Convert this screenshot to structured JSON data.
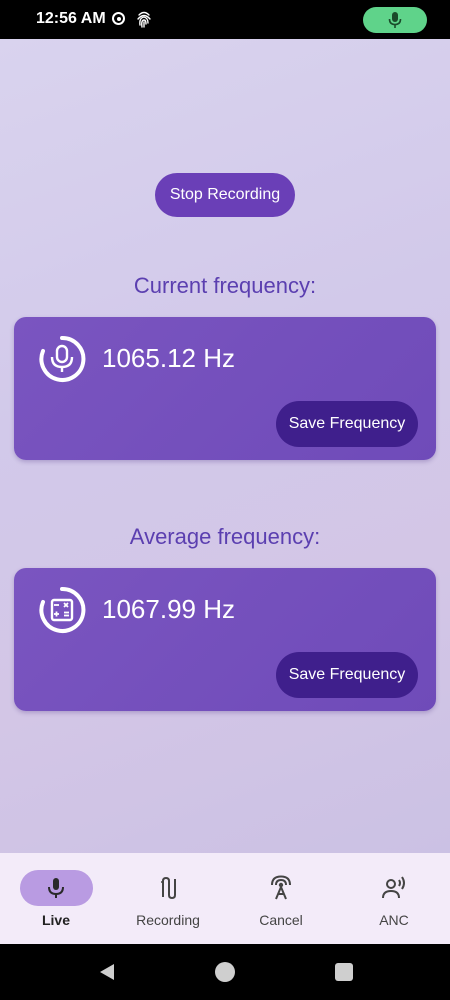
{
  "status_bar": {
    "time": "12:56 AM"
  },
  "main": {
    "stop_button": "Stop Recording",
    "current": {
      "title": "Current frequency:",
      "value": "1065.12 Hz",
      "save_label": "Save Frequency"
    },
    "average": {
      "title": "Average frequency:",
      "value": "1067.99 Hz",
      "save_label": "Save Frequency"
    }
  },
  "nav": {
    "items": [
      {
        "label": "Live",
        "icon": "mic-icon",
        "active": true
      },
      {
        "label": "Recording",
        "icon": "recording-icon",
        "active": false
      },
      {
        "label": "Cancel",
        "icon": "antenna-icon",
        "active": false
      },
      {
        "label": "ANC",
        "icon": "voice-icon",
        "active": false
      }
    ]
  },
  "colors": {
    "primary": "#6a3fb7",
    "card": "#7a55c0",
    "save_button": "#3f1f8c",
    "title_text": "#5b3fb0",
    "mic_pill": "#5fd38a",
    "nav_indicator": "#b99be2"
  }
}
